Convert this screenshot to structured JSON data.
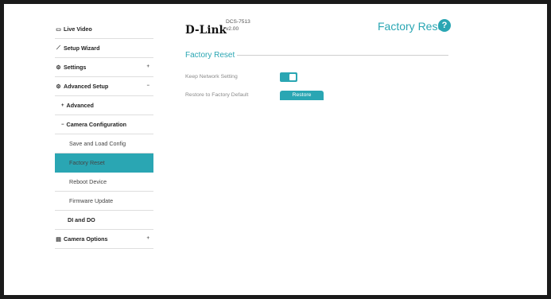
{
  "header": {
    "logo": "D-Link",
    "model": "DCS-7513",
    "version": "v2.00",
    "title": "Factory Reset",
    "help_glyph": "?"
  },
  "sidebar": {
    "items": [
      {
        "label": "Live Video",
        "icon": "video-icon"
      },
      {
        "label": "Setup Wizard",
        "icon": "wizard-icon"
      },
      {
        "label": "Settings",
        "icon": "gear-icon",
        "caret": "+"
      },
      {
        "label": "Advanced Setup",
        "icon": "advanced-gear-icon",
        "caret": "−"
      },
      {
        "label": "Advanced",
        "prefix": "+"
      },
      {
        "label": "Camera Configuration",
        "prefix": "−"
      },
      {
        "label": "Save and Load Config"
      },
      {
        "label": "Factory Reset",
        "active": true
      },
      {
        "label": "Reboot Device"
      },
      {
        "label": "Firmware Update"
      },
      {
        "label": "DI and DO"
      },
      {
        "label": "Camera Options",
        "icon": "document-icon",
        "caret": "+"
      }
    ]
  },
  "section": {
    "title": "Factory Reset",
    "keep_network_label": "Keep Network Setting",
    "keep_network_enabled": true,
    "restore_label": "Restore to Factory Default",
    "restore_button": "Restore"
  },
  "colors": {
    "accent": "#2aa6b3",
    "frame": "#1a1a1a"
  }
}
